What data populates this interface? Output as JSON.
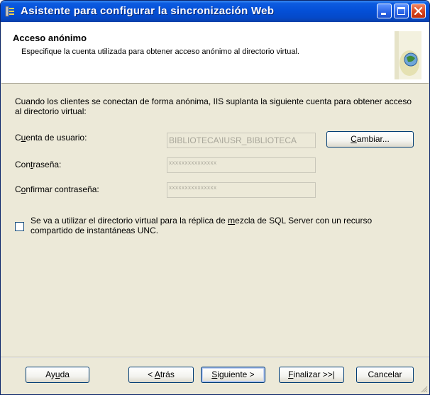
{
  "window": {
    "title": "Asistente para configurar la sincronización Web"
  },
  "header": {
    "title": "Acceso anónimo",
    "description": "Especifique la cuenta utilizada para obtener acceso anónimo al directorio virtual."
  },
  "body": {
    "intro": "Cuando los clientes se conectan de forma anónima, IIS suplanta la siguiente cuenta para obtener acceso al directorio virtual:",
    "user_account": {
      "label_pre": "C",
      "label_key": "u",
      "label_post": "enta de usuario:",
      "value": "BIBLIOTECA\\IUSR_BIBLIOTECA"
    },
    "change_button": {
      "key": "C",
      "rest": "ambiar..."
    },
    "password": {
      "label_pre": "Con",
      "label_key": "t",
      "label_post": "raseña:",
      "value": "xxxxxxxxxxxxxxx"
    },
    "confirm_password": {
      "label_pre": "C",
      "label_key": "o",
      "label_post": "nfirmar contraseña:",
      "value": "xxxxxxxxxxxxxxx"
    },
    "unc_checkbox": {
      "checked": false,
      "label_pre": "Se va a utilizar el directorio virtual para la réplica de ",
      "label_key": "m",
      "label_post": "ezcla de SQL Server con un recurso compartido de instantáneas UNC."
    }
  },
  "footer": {
    "help": {
      "pre": "Ay",
      "key": "u",
      "post": "da"
    },
    "back": {
      "pre": "< ",
      "key": "A",
      "post": "trás"
    },
    "next": {
      "pre": "",
      "key": "S",
      "post": "iguiente >"
    },
    "finish": {
      "pre": "",
      "key": "F",
      "post": "inalizar >>|"
    },
    "cancel": {
      "label": "Cancelar"
    }
  },
  "colors": {
    "titlebar": "#0450d8",
    "dialog_bg": "#ece9d8",
    "header_bg": "#ffffff",
    "close_button": "#d9451d"
  }
}
